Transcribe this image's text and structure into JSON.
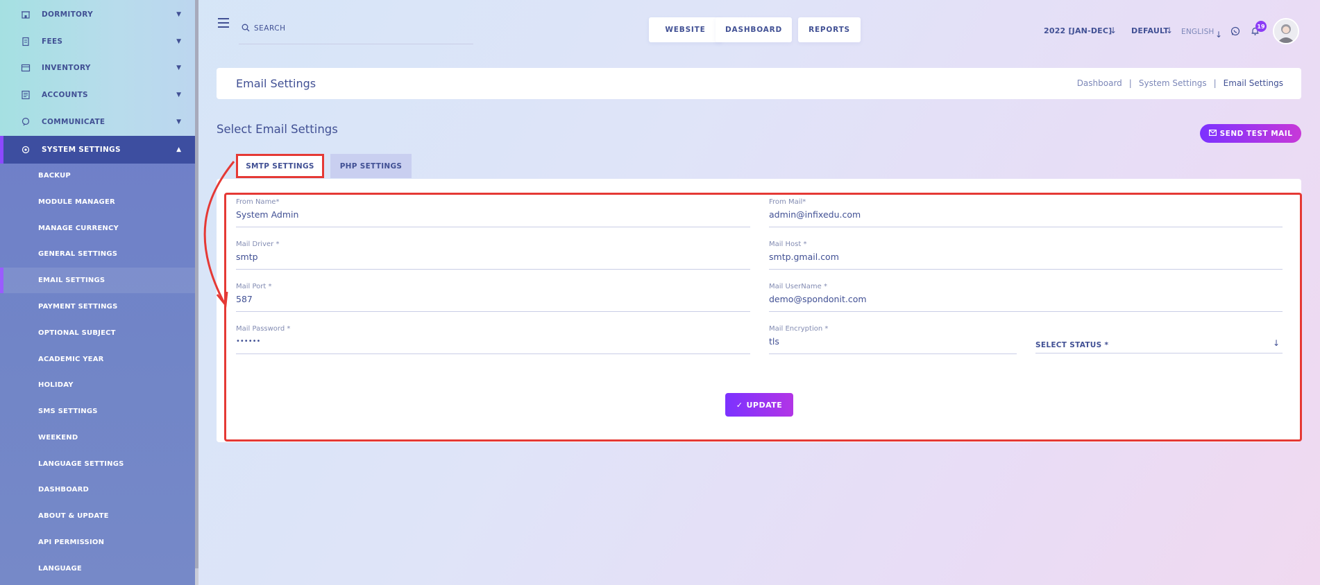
{
  "sidebar": {
    "top_items": [
      {
        "label": "DORMITORY",
        "icon": "building-icon"
      },
      {
        "label": "FEES",
        "icon": "receipt-icon"
      },
      {
        "label": "INVENTORY",
        "icon": "inventory-icon"
      },
      {
        "label": "ACCOUNTS",
        "icon": "accounts-icon"
      },
      {
        "label": "COMMUNICATE",
        "icon": "communicate-icon"
      }
    ],
    "active_item": {
      "label": "SYSTEM SETTINGS",
      "icon": "gear-icon"
    },
    "sub_items": [
      "BACKUP",
      "MODULE MANAGER",
      "MANAGE CURRENCY",
      "GENERAL SETTINGS",
      "EMAIL SETTINGS",
      "PAYMENT SETTINGS",
      "OPTIONAL SUBJECT",
      "ACADEMIC YEAR",
      "HOLIDAY",
      "SMS SETTINGS",
      "WEEKEND",
      "LANGUAGE SETTINGS",
      "DASHBOARD",
      "ABOUT & UPDATE",
      "API PERMISSION",
      "LANGUAGE"
    ]
  },
  "header": {
    "search_placeholder": "SEARCH",
    "buttons": [
      "WEBSITE",
      "DASHBOARD",
      "REPORTS"
    ],
    "session": "2022 [JAN-DEC]",
    "theme": "DEFAULT",
    "language": "ENGLISH",
    "notification_count": "19"
  },
  "page": {
    "title": "Email Settings",
    "breadcrumb": [
      "Dashboard",
      "System Settings",
      "Email Settings"
    ],
    "section_title": "Select Email Settings",
    "send_test_label": "SEND TEST MAIL"
  },
  "tabs": [
    "SMTP SETTINGS",
    "PHP SETTINGS"
  ],
  "form": {
    "from_name": {
      "label": "From Name*",
      "value": "System Admin"
    },
    "from_mail": {
      "label": "From Mail*",
      "value": "admin@infixedu.com"
    },
    "mail_driver": {
      "label": "Mail Driver *",
      "value": "smtp"
    },
    "mail_host": {
      "label": "Mail Host *",
      "value": "smtp.gmail.com"
    },
    "mail_port": {
      "label": "Mail Port *",
      "value": "587"
    },
    "mail_username": {
      "label": "Mail UserName *",
      "value": "demo@spondonit.com"
    },
    "mail_password": {
      "label": "Mail Password *",
      "value": "••••••"
    },
    "mail_encryption": {
      "label": "Mail Encryption *",
      "value": "tls"
    },
    "select_status": "SELECT STATUS *",
    "update_label": "UPDATE"
  },
  "colors": {
    "primary_text": "#415094",
    "accent_purple": "#7c32ff",
    "highlight_red": "#e53935"
  }
}
